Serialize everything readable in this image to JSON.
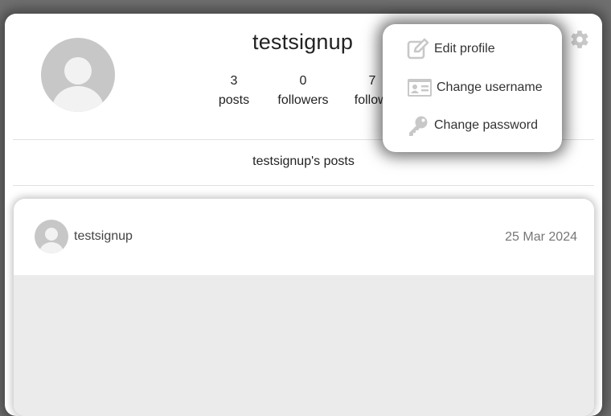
{
  "profile": {
    "username": "testsignup",
    "stats": [
      {
        "value": "3",
        "label": "posts"
      },
      {
        "value": "0",
        "label": "followers"
      },
      {
        "value": "7",
        "label": "followi"
      }
    ],
    "posts_heading": "testsignup's posts"
  },
  "settings_menu": {
    "items": [
      {
        "label": "Edit profile",
        "icon": "edit-icon"
      },
      {
        "label": "Change username",
        "icon": "id-card-icon"
      },
      {
        "label": "Change password",
        "icon": "key-icon"
      }
    ]
  },
  "post": {
    "username": "testsignup",
    "date": "25 Mar 2024"
  },
  "colors": {
    "overlay": "#6f6f6f",
    "surface": "#ffffff",
    "avatar": "#c7c7c7",
    "icon": "#c8c8c8"
  }
}
